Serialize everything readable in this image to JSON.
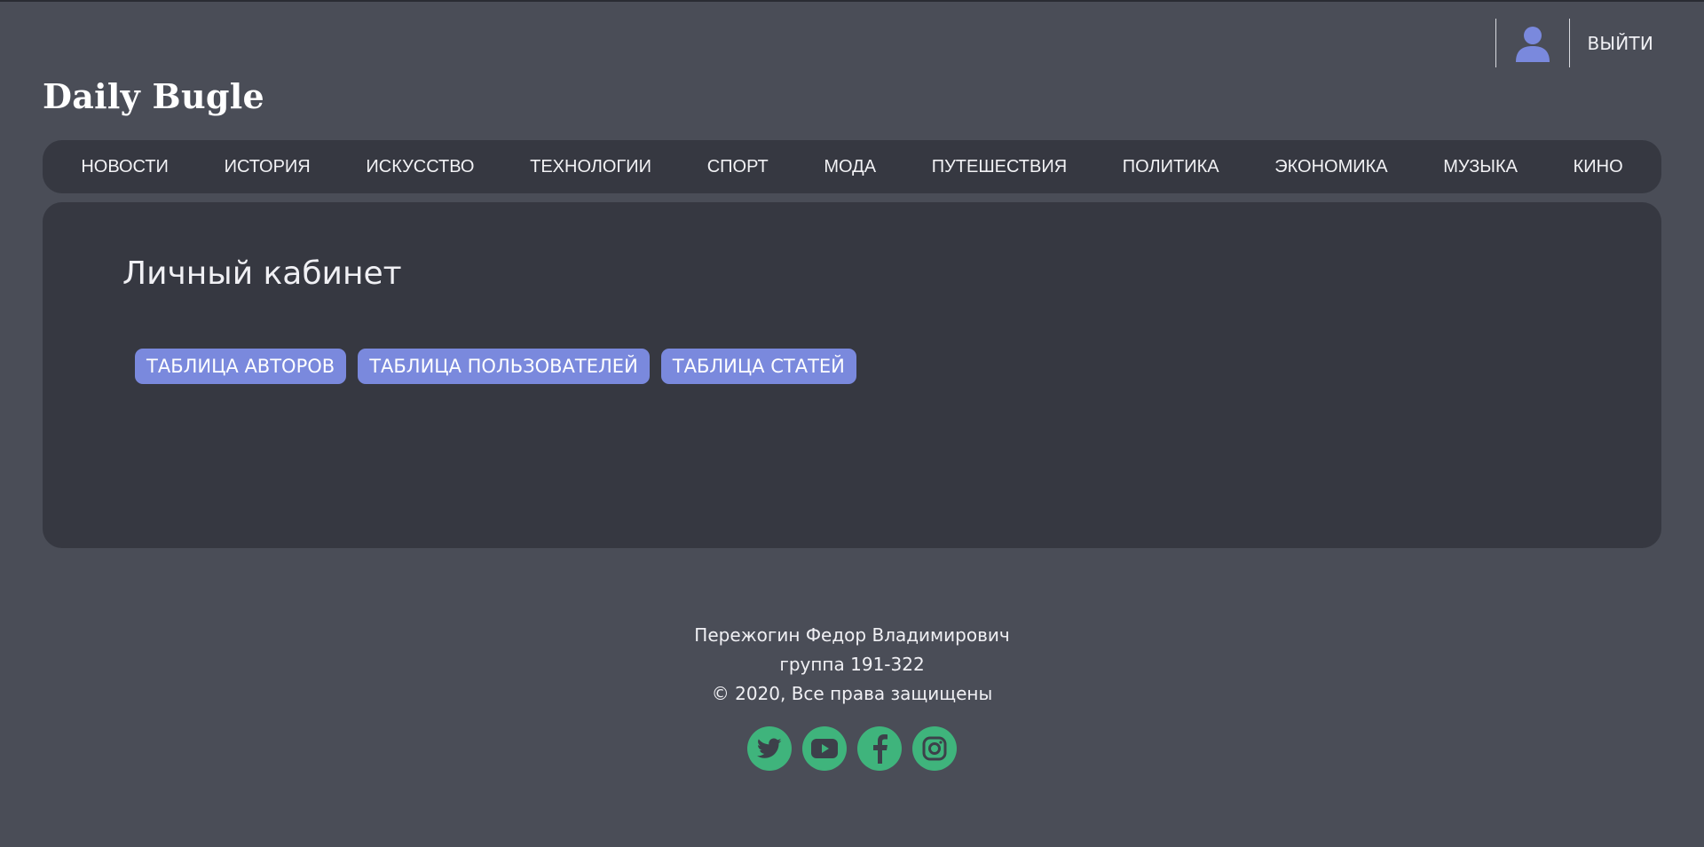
{
  "header": {
    "logo": "Daily Bugle",
    "user_icon": "user-icon",
    "logout_label": "ВЫЙТИ"
  },
  "nav": {
    "items": [
      {
        "label": "НОВОСТИ"
      },
      {
        "label": "ИСТОРИЯ"
      },
      {
        "label": "ИСКУССТВО"
      },
      {
        "label": "ТЕХНОЛОГИИ"
      },
      {
        "label": "СПОРТ"
      },
      {
        "label": "МОДА"
      },
      {
        "label": "ПУТЕШЕСТВИЯ"
      },
      {
        "label": "ПОЛИТИКА"
      },
      {
        "label": "ЭКОНОМИКА"
      },
      {
        "label": "МУЗЫКА"
      },
      {
        "label": "КИНО"
      }
    ]
  },
  "main": {
    "title": "Личный кабинет",
    "buttons": [
      {
        "label": "ТАБЛИЦА АВТОРОВ"
      },
      {
        "label": "ТАБЛИЦА ПОЛЬЗОВАТЕЛЕЙ"
      },
      {
        "label": "ТАБЛИЦА СТАТЕЙ"
      }
    ]
  },
  "footer": {
    "author": "Пережогин Федор Владимирович",
    "group": "группа 191-322",
    "copyright": "© 2020, Все права защищены",
    "socials": [
      {
        "icon": "twitter-icon"
      },
      {
        "icon": "youtube-icon"
      },
      {
        "icon": "facebook-icon"
      },
      {
        "icon": "instagram-icon"
      }
    ]
  },
  "colors": {
    "background": "#4a4d57",
    "panel": "#363841",
    "accent_button": "#7a89dd",
    "social": "#3fb47c",
    "user_icon": "#7a89dd"
  }
}
